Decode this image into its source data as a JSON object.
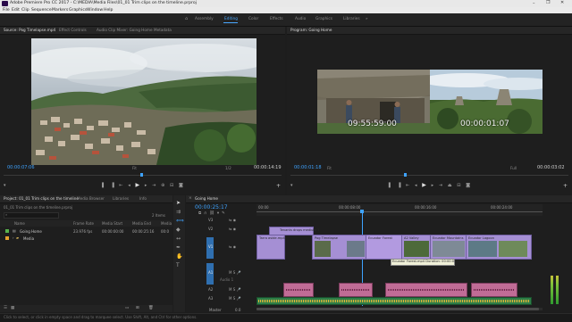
{
  "app": {
    "title": "Adobe Premiere Pro CC 2017 - C:\\MEDIA\\Media Files\\01_01 Trim clips on the timeline.prproj",
    "window_controls": [
      "–",
      "❐",
      "✕"
    ]
  },
  "menu": [
    "File",
    "Edit",
    "Clip",
    "Sequence",
    "Markers",
    "Graphics",
    "Window",
    "Help"
  ],
  "workspaces": [
    "Assembly",
    "Editing",
    "Color",
    "Effects",
    "Audio",
    "Graphics",
    "Libraries"
  ],
  "active_workspace": "Editing",
  "source_panel": {
    "tabs": [
      "Source: Pog Timelapse.mp4",
      "Effect Controls",
      "Audio Clip Mixer: Going Home",
      "Metadata"
    ],
    "timecode_left": "00:00:07:06",
    "fit": "Fit",
    "zoom": "1/2",
    "timecode_right": "00:00:14:19"
  },
  "program_panel": {
    "tabs": [
      "Program: Going Home"
    ],
    "overlay_left": "09:55:59:00",
    "overlay_right": "00:00:01:07",
    "timecode_left": "00:00:01:18",
    "fit": "Fit",
    "zoom": "Full",
    "timecode_right": "00:00:03:02"
  },
  "project_panel": {
    "tabs": [
      "Project: 01_01 Trim clips on the timeline",
      "Media Browser",
      "Libraries",
      "Info"
    ],
    "path": "01_01 Trim clips on the timeline.prproj",
    "item_count": "2 Items",
    "columns": [
      "Name",
      "Frame Rate",
      "Media Start",
      "Media End",
      "Media"
    ],
    "rows": [
      {
        "name": "Going Home",
        "frame_rate": "23.976 fps",
        "media_start": "00:00:00:00",
        "media_end": "00:00:25:16",
        "media": "00:0",
        "color": "#59b24d"
      },
      {
        "name": "Media",
        "frame_rate": "",
        "media_start": "",
        "media_end": "",
        "media": "",
        "color": "#e8a22e"
      }
    ]
  },
  "timeline": {
    "tab": "Going Home",
    "timecode": "00:00:25:17",
    "ruler": [
      "00:00",
      "00:00:08:00",
      "00:00:16:00",
      "00:00:24:00"
    ],
    "video_tracks": [
      "V3",
      "V2",
      "V1"
    ],
    "audio_tracks": [
      "A1",
      "A2",
      "A3"
    ],
    "audio_label": "Audio 1",
    "master_label": "Master",
    "master_value": "0.0",
    "clip_labels": {
      "v2_clip": "Tenants drops medium 1",
      "v1_clip_a": "Tarra aside.mp4",
      "v1_clip_b": "Pog Timelapse",
      "v1_clip_c": "Ecuador Forest",
      "v1_clip_d": "A2 Valley",
      "v1_clip_e": "Ecuador Mountains",
      "v1_clip_f": "Ecuador Lagoon",
      "tooltip": "Ecuador Forest.mp4 Duration: 00:00:03:16"
    }
  },
  "status": {
    "text": "Click to select, or click in empty space and drag to marquee select. Use Shift, Alt, and Ctrl for other options."
  },
  "colors": {
    "accent_blue": "#3ea3ff",
    "video_clip": "#a58fd4",
    "audio_clip": "#c06c96"
  }
}
